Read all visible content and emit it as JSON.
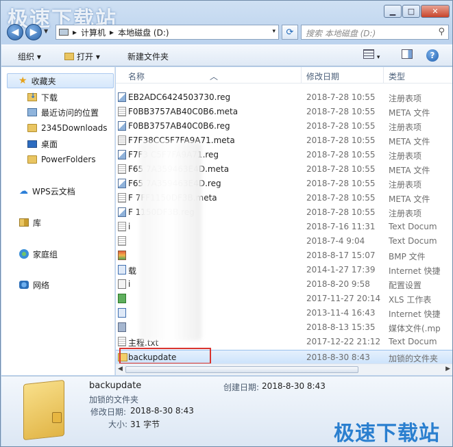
{
  "watermark": "极速下载站",
  "window_buttons": {
    "minimize": "▁",
    "maximize": "□",
    "close": "✕"
  },
  "address": {
    "crumb1": "计算机",
    "crumb2": "本地磁盘 (D:)",
    "sep": "▸",
    "dropdown": "▾",
    "refresh_glyph": "⟳"
  },
  "search": {
    "placeholder": "搜索 本地磁盘 (D:)"
  },
  "toolbar": {
    "organize": "组织 ▾",
    "open": "打开 ▾",
    "new_folder": "新建文件夹",
    "help": "?"
  },
  "sidebar": {
    "items": [
      {
        "label": "收藏夹",
        "icon": "star-icon"
      },
      {
        "label": "下载",
        "icon": "download-folder-icon"
      },
      {
        "label": "最近访问的位置",
        "icon": "recent-places-icon"
      },
      {
        "label": "2345Downloads",
        "icon": "folder-icon"
      },
      {
        "label": "桌面",
        "icon": "desktop-icon"
      },
      {
        "label": "PowerFolders",
        "icon": "folder-icon"
      },
      {
        "label": "WPS云文档",
        "icon": "cloud-icon"
      },
      {
        "label": "库",
        "icon": "library-icon"
      },
      {
        "label": "家庭组",
        "icon": "homegroup-icon"
      },
      {
        "label": "网络",
        "icon": "network-icon"
      }
    ]
  },
  "columns": {
    "name": "名称",
    "modified": "修改日期",
    "type": "类型"
  },
  "files": [
    {
      "name": "EB2ADC6424503730.reg",
      "date": "2018-7-28 10:55",
      "type": "注册表项",
      "icon": "reg"
    },
    {
      "name": "F0BB3757AB40C0B6.meta",
      "date": "2018-7-28 10:55",
      "type": "META 文件",
      "icon": "txt"
    },
    {
      "name": "F0BB3757AB40C0B6.reg",
      "date": "2018-7-28 10:55",
      "type": "注册表项",
      "icon": "reg"
    },
    {
      "name": "F7F38CC5F7FA9A71.meta",
      "date": "2018-7-28 10:55",
      "type": "META 文件",
      "icon": "txt"
    },
    {
      "name": "F7F3 C5F7FA9A71.reg",
      "date": "2018-7-28 10:55",
      "type": "注册表项",
      "icon": "reg"
    },
    {
      "name": "F65 7A359463E4D.meta",
      "date": "2018-7-28 10:55",
      "type": "META 文件",
      "icon": "txt"
    },
    {
      "name": "F65 7A359463E4D.reg",
      "date": "2018-7-28 10:55",
      "type": "注册表项",
      "icon": "reg"
    },
    {
      "name": "F 7FF1150DF3B.meta",
      "date": "2018-7-28 10:55",
      "type": "META 文件",
      "icon": "txt"
    },
    {
      "name": "F 1150DF3B.reg",
      "date": "2018-7-28 10:55",
      "type": "注册表项",
      "icon": "reg"
    },
    {
      "name": "i",
      "date": "2018-7-16 11:31",
      "type": "Text Docum",
      "icon": "txt"
    },
    {
      "name": "",
      "date": "2018-7-4 9:04",
      "type": "Text Docum",
      "icon": "txt"
    },
    {
      "name": "",
      "date": "2018-8-17 15:07",
      "type": "BMP 文件",
      "icon": "bmp"
    },
    {
      "name": "载",
      "date": "2014-1-27 17:39",
      "type": "Internet 快捷",
      "icon": "lnk"
    },
    {
      "name": "i",
      "date": "2018-8-20 9:58",
      "type": "配置设置",
      "icon": "ini"
    },
    {
      "name": "",
      "date": "2017-11-27 20:14",
      "type": "XLS 工作表",
      "icon": "xls"
    },
    {
      "name": "",
      "date": "2013-11-4 16:43",
      "type": "Internet 快捷",
      "icon": "lnk"
    },
    {
      "name": "",
      "date": "2018-8-13 15:35",
      "type": "媒体文件(.mp",
      "icon": "mp"
    },
    {
      "name": "主程.txt",
      "date": "2017-12-22 21:12",
      "type": "Text Docum",
      "icon": "txt"
    },
    {
      "name": "backupdate",
      "date": "2018-8-30 8:43",
      "type": "加锁的文件夹",
      "icon": "lockfolder"
    }
  ],
  "details": {
    "name": "backupdate",
    "kind": "加锁的文件夹",
    "modified_label": "修改日期:",
    "modified": "2018-8-30 8:43",
    "size_label": "大小:",
    "size": "31 字节",
    "created_label": "创建日期:",
    "created": "2018-8-30 8:43"
  }
}
